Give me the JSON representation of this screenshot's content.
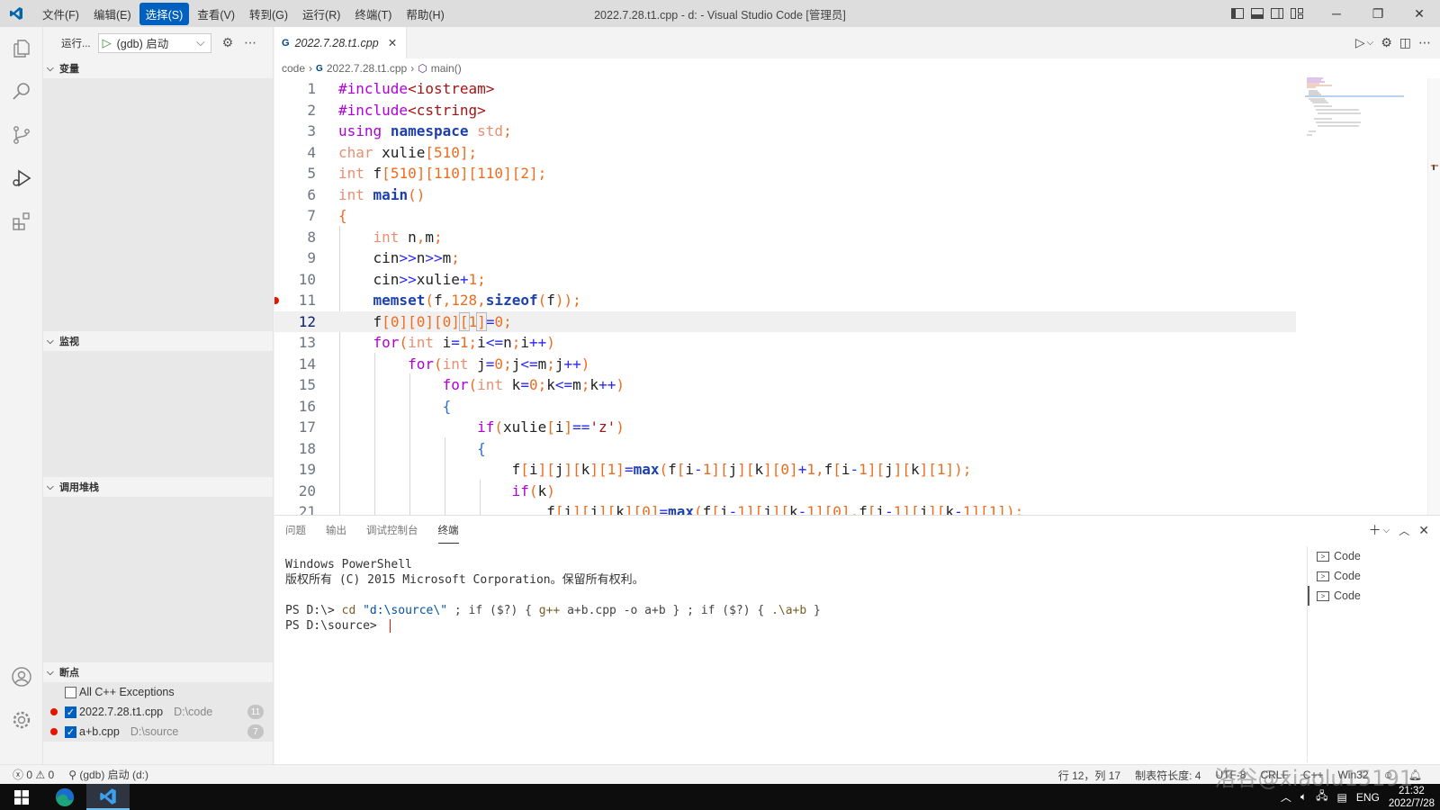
{
  "menu": {
    "items": [
      "文件(F)",
      "编辑(E)",
      "选择(S)",
      "查看(V)",
      "转到(G)",
      "运行(R)",
      "终端(T)",
      "帮助(H)"
    ],
    "active_index": 2
  },
  "window": {
    "title": "2022.7.28.t1.cpp - d: - Visual Studio Code [管理员]"
  },
  "sidebar": {
    "run_label": "运行...",
    "config": "(gdb) 启动",
    "sections": {
      "variables": "变量",
      "watch": "监视",
      "callstack": "调用堆栈",
      "breakpoints": "断点"
    },
    "breakpoints": [
      {
        "label": "All C++ Exceptions",
        "checked": false,
        "path": "",
        "count": ""
      },
      {
        "label": "2022.7.28.t1.cpp",
        "checked": true,
        "path": "D:\\code",
        "count": "11"
      },
      {
        "label": "a+b.cpp",
        "checked": true,
        "path": "D:\\source",
        "count": "7"
      }
    ]
  },
  "editor": {
    "tab_label": "2022.7.28.t1.cpp",
    "breadcrumb": {
      "folder": "code",
      "file": "2022.7.28.t1.cpp",
      "symbol": "main()"
    },
    "current_line": 12,
    "breakpoint_line": 11,
    "line_numbers": [
      "1",
      "2",
      "3",
      "4",
      "5",
      "6",
      "7",
      "8",
      "9",
      "10",
      "11",
      "12",
      "13",
      "14",
      "15",
      "16",
      "17",
      "18",
      "19",
      "20",
      "21"
    ]
  },
  "panel": {
    "tabs": [
      "问题",
      "输出",
      "调试控制台",
      "终端"
    ],
    "active_tab": "终端",
    "terminal": {
      "line1": "Windows PowerShell",
      "line2": "版权所有 (C) 2015 Microsoft Corporation。保留所有权利。",
      "prompt1": "PS D:\\> ",
      "cmd_cd": "cd",
      "cmd_path": "\"d:\\source\\\"",
      "cmd_rest1": " ; if ($?) { ",
      "cmd_gpp": "g++",
      "cmd_rest2": " a+b.cpp -o a+b } ; if ($?) { ",
      "cmd_run": ".\\a+b",
      "cmd_rest3": " }",
      "prompt2": "PS D:\\source>"
    },
    "terminal_list": [
      "Code",
      "Code",
      "Code"
    ]
  },
  "statusbar": {
    "errors": "0",
    "warnings": "0",
    "debug_config": "(gdb) 启动 (d:)",
    "position": "行 12，列 17",
    "tab_size": "制表符长度: 4",
    "encoding": "UTF-8",
    "eol": "CRLF",
    "language": "C++",
    "platform": "Win32"
  },
  "taskbar": {
    "lang": "ENG",
    "time": "21:32",
    "date": "2022/7/28"
  },
  "watermark": "洛谷@xiaolu15191",
  "colors": {
    "accent": "#0060c0",
    "breakpoint": "#e51400",
    "keyword": "#af00db",
    "type": "#e98f6f",
    "function": "#1e40af",
    "number": "#ef6c1e"
  }
}
